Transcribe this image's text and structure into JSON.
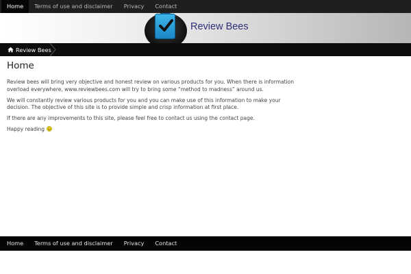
{
  "top_nav": {
    "items": [
      {
        "label": "Home"
      },
      {
        "label": "Terms of use and disclaimer"
      },
      {
        "label": "Privacy"
      },
      {
        "label": "Contact"
      }
    ]
  },
  "banner": {
    "logo_text": "Review Bees",
    "logo_icon": "clipboard-check-icon"
  },
  "breadcrumb": {
    "label": "Review Bees",
    "icon": "home-icon"
  },
  "main": {
    "title": "Home",
    "paragraphs": [
      "Review bees will bring very objective and honest review on various products for you. When there is information overload everywhere, www.reviewbees.com will try to bring some “method to madness” around us.",
      "We will constantly review various products for you and you can make use of this information to make your decision. The objective of this site is to provide simple and crisp information at first place.",
      "If there are any improvements to this site, please feel free to contact us using the contact page."
    ],
    "closing": "Happy reading",
    "closing_icon": "smiley-icon"
  },
  "footer_nav": {
    "items": [
      {
        "label": "Home"
      },
      {
        "label": "Terms of use and disclaimer"
      },
      {
        "label": "Privacy"
      },
      {
        "label": "Contact"
      }
    ]
  },
  "colors": {
    "nav_bg": "#1f1f1f",
    "nav_active_bg": "#050505",
    "logo_text": "#2d2f78",
    "clipboard_blue": "#29a3dd"
  }
}
